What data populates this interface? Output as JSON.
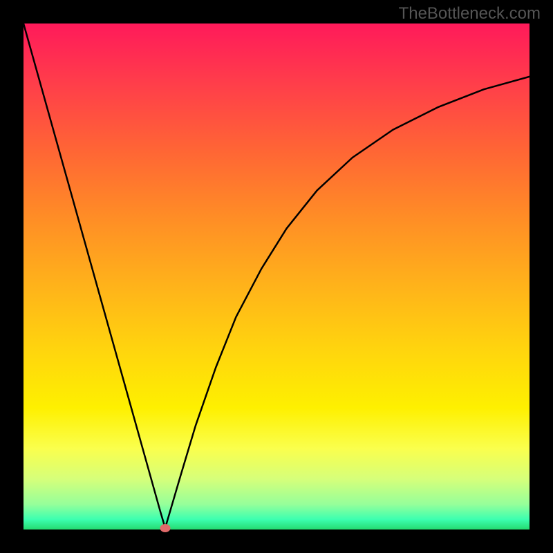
{
  "watermark": "TheBottleneck.com",
  "chart_data": {
    "type": "line",
    "title": "",
    "xlabel": "",
    "ylabel": "",
    "xlim": [
      0,
      1
    ],
    "ylim": [
      0,
      1
    ],
    "dot": {
      "x": 0.28,
      "y": 0.003
    },
    "series": [
      {
        "name": "curve",
        "x": [
          0.0,
          0.03,
          0.06,
          0.09,
          0.12,
          0.15,
          0.18,
          0.21,
          0.24,
          0.27,
          0.28,
          0.29,
          0.31,
          0.34,
          0.38,
          0.42,
          0.47,
          0.52,
          0.58,
          0.65,
          0.73,
          0.82,
          0.91,
          1.0
        ],
        "y": [
          1.0,
          0.893,
          0.786,
          0.679,
          0.572,
          0.465,
          0.358,
          0.251,
          0.144,
          0.037,
          0.003,
          0.037,
          0.105,
          0.205,
          0.32,
          0.42,
          0.515,
          0.595,
          0.67,
          0.735,
          0.79,
          0.835,
          0.87,
          0.895
        ]
      }
    ]
  }
}
